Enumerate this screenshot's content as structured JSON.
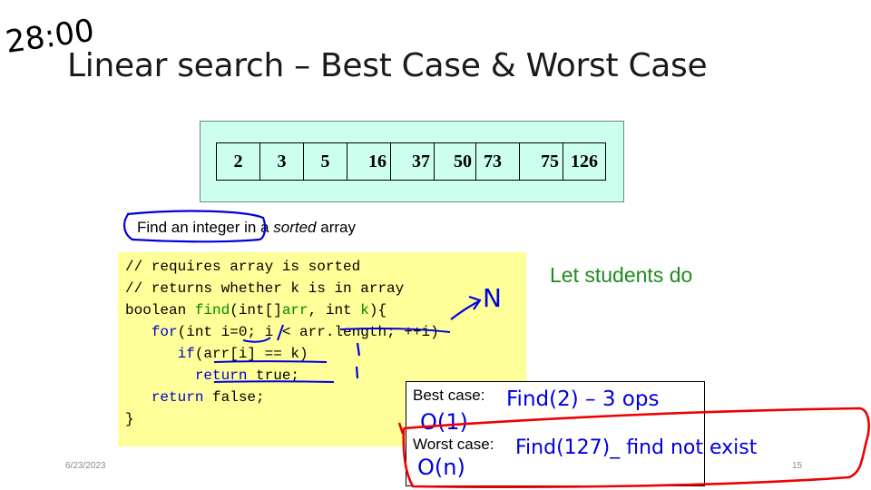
{
  "slide": {
    "handwritten_timer": "28:00",
    "title": "Linear search – Best Case & Worst Case",
    "array": [
      "2",
      "3",
      "5",
      "16",
      "37",
      "50",
      "73",
      "75",
      "126"
    ],
    "caption": {
      "before": "Find an integer in a ",
      "italic": "sorted",
      "after": " array"
    },
    "code_lines": [
      "// requires array is sorted",
      "// returns whether k is in array",
      "boolean find(int[]arr, int k){",
      "   for(int i=0; i < arr.length; ++i)",
      "      if(arr[i] == k)",
      "        return true;",
      "   return false;",
      "}"
    ],
    "note": "Let students do",
    "best_case_label": "Best case:",
    "worst_case_label": "Worst case:",
    "annotations": {
      "n_mark": "N",
      "best_find": "Find(2) – 3 ops",
      "best_order": "O(1)",
      "worst_find": "Find(127)_ find  not exist",
      "worst_order": "O(n)"
    },
    "footer_date": "6/23/2023",
    "page_number": "15"
  },
  "colors": {
    "array_bg": "#ccffee",
    "code_bg": "#ffff99",
    "note_text": "#1e8c1e",
    "ink_blue": "#0000dd",
    "ink_red": "#ee0000"
  }
}
